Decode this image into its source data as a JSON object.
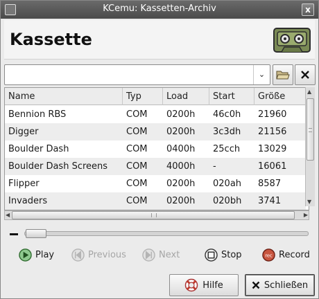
{
  "window": {
    "title": "KCemu: Kassetten-Archiv",
    "close_glyph": "x"
  },
  "header": {
    "title": "Kassette",
    "icon": "cassette-icon"
  },
  "file_combo": {
    "value": "",
    "dropdown_glyph": "⌄"
  },
  "table": {
    "columns": [
      "Name",
      "Typ",
      "Load",
      "Start",
      "Größe"
    ],
    "rows": [
      [
        "Bennion RBS",
        "COM",
        "0200h",
        "46c0h",
        "21960"
      ],
      [
        "Digger",
        "COM",
        "0200h",
        "3c3dh",
        "21156"
      ],
      [
        "Boulder Dash",
        "COM",
        "0400h",
        "25cch",
        "13029"
      ],
      [
        "Boulder Dash Screens",
        "COM",
        "4000h",
        "-",
        "16061"
      ],
      [
        "Flipper",
        "COM",
        "0200h",
        "020ah",
        "8587"
      ],
      [
        "Invaders",
        "COM",
        "0200h",
        "020bh",
        "3741"
      ]
    ]
  },
  "transport": {
    "play": "Play",
    "previous": "Previous",
    "next": "Next",
    "stop": "Stop",
    "record": "Record",
    "record_icon_text": "rec"
  },
  "buttons": {
    "help": "Hilfe",
    "close": "Schließen"
  },
  "colors": {
    "play": "#4aa04a",
    "record": "#b04030",
    "titlebar": "#555555"
  }
}
